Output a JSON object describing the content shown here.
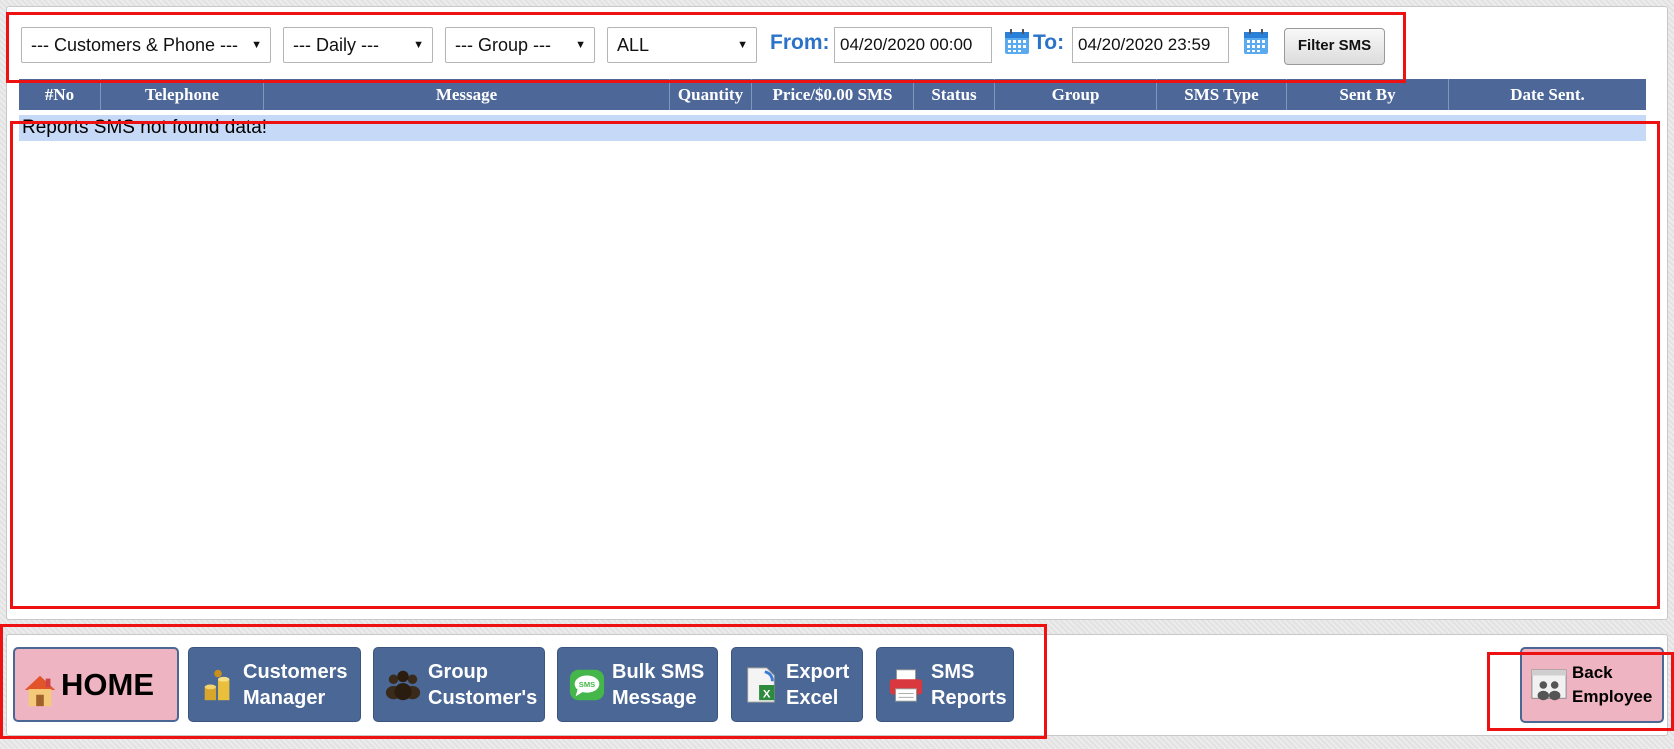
{
  "filters": {
    "customer_select": "--- Customers & Phone ---",
    "period_select": "--- Daily ---",
    "group_select": "--- Group ---",
    "status_select": "ALL",
    "from_label": "From:",
    "from_value": "04/20/2020 00:00",
    "to_label": "To:",
    "to_value": "04/20/2020 23:59",
    "filter_button": "Filter SMS"
  },
  "table": {
    "columns": [
      "#No",
      "Telephone",
      "Message",
      "Quantity",
      "Price/$0.00 SMS",
      "Status",
      "Group",
      "SMS Type",
      "Sent By",
      "Date Sent."
    ],
    "empty_message": "Reports SMS not found data!"
  },
  "nav": {
    "home": "HOME",
    "customers_manager": [
      "Customers",
      "Manager"
    ],
    "group_customers": [
      "Group",
      "Customer's"
    ],
    "bulk_sms": [
      "Bulk SMS",
      "Message"
    ],
    "export_excel": [
      "Export",
      "Excel"
    ],
    "sms_reports": [
      "SMS",
      "Reports"
    ],
    "back_employee": [
      "Back",
      "Employee"
    ]
  },
  "icons": {
    "calendar": "calendar-icon",
    "home": "house-icon",
    "customers": "coins-icon",
    "group": "people-icon",
    "bulk": "sms-bubble-icon",
    "excel": "excel-icon",
    "reports": "printer-icon",
    "back": "employee-icon"
  },
  "colors": {
    "header_bg": "#4d6898",
    "button_bg": "#4a6795",
    "home_bg": "#efb4c1",
    "label_blue": "#2a73c9",
    "empty_row_bg": "#c6daf7",
    "annotation_red": "#ee1111"
  }
}
